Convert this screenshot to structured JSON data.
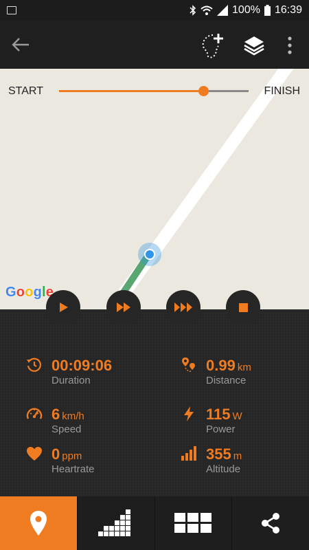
{
  "status_bar": {
    "battery": "100%",
    "time": "16:39"
  },
  "toolbar": {
    "back_icon": "arrow-left-icon",
    "route_icon": "route-add-icon",
    "layers_icon": "layers-icon",
    "more_icon": "more-vert-icon"
  },
  "replay": {
    "start_label": "START",
    "finish_label": "FINISH",
    "progress": 0.76
  },
  "map": {
    "attribution": "Google"
  },
  "controls": [
    "play-icon",
    "fast-forward-icon",
    "fast-forward-more-icon",
    "stop-icon"
  ],
  "stats": {
    "duration": {
      "value": "00:09:06",
      "unit": "",
      "label": "Duration"
    },
    "distance": {
      "value": "0.99",
      "unit": "km",
      "label": "Distance"
    },
    "speed": {
      "value": "6",
      "unit": "km/h",
      "label": "Speed"
    },
    "power": {
      "value": "115",
      "unit": "W",
      "label": "Power"
    },
    "heartrate": {
      "value": "0",
      "unit": "ppm",
      "label": "Heartrate"
    },
    "altitude": {
      "value": "355",
      "unit": "m",
      "label": "Altitude"
    }
  },
  "bottom_nav": [
    "map-pin-icon",
    "graph-icon",
    "dashboard-grid-icon",
    "share-icon"
  ],
  "colors": {
    "accent": "#f07c22",
    "panel": "#262626",
    "map_bg": "#ebe8df",
    "track": "#5aa673",
    "location": "#2f95e6"
  }
}
